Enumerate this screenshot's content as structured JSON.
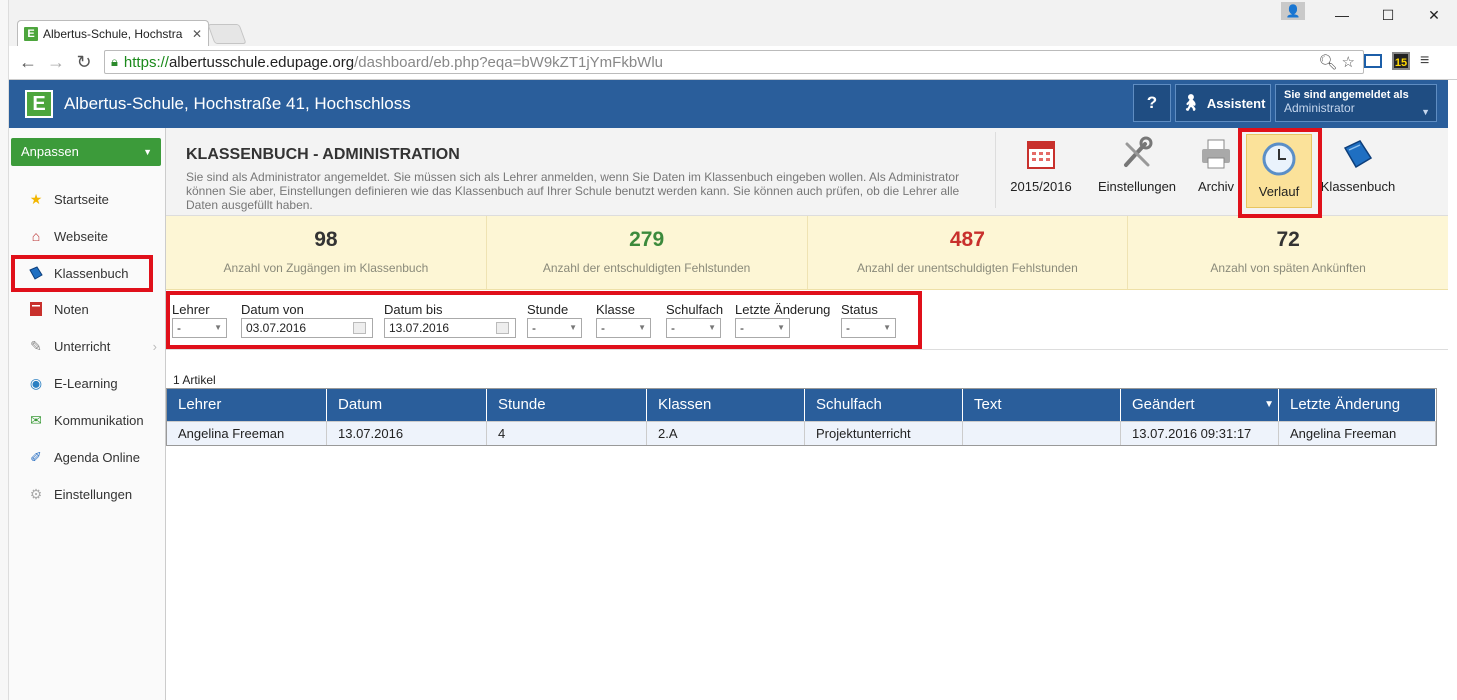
{
  "browser": {
    "tab_title": "Albertus-Schule, Hochstra",
    "url_https": "https://",
    "url_host": "albertusschule.edupage.org",
    "url_path": "/dashboard/eb.php?eqa=bW9kZT1jYmFkbWlu",
    "ext_badge": "15"
  },
  "header": {
    "logo_letter": "E",
    "school_name": "Albertus-Schule, Hochstraße 41, Hochschloss",
    "help_label": "?",
    "assistant_label": "Assistent",
    "login_label": "Sie sind angemeldet als",
    "login_user": "Administrator"
  },
  "sidebar": {
    "anpassen_label": "Anpassen",
    "items": [
      {
        "label": "Startseite",
        "icon": "star-icon"
      },
      {
        "label": "Webseite",
        "icon": "house-icon"
      },
      {
        "label": "Klassenbuch",
        "icon": "book-icon"
      },
      {
        "label": "Noten",
        "icon": "grades-icon"
      },
      {
        "label": "Unterricht",
        "icon": "teaching-icon"
      },
      {
        "label": "E-Learning",
        "icon": "elearning-icon"
      },
      {
        "label": "Kommunikation",
        "icon": "communication-icon"
      },
      {
        "label": "Agenda Online",
        "icon": "pen-icon"
      },
      {
        "label": "Einstellungen",
        "icon": "settings-icon"
      }
    ]
  },
  "page": {
    "title": "KLASSENBUCH - ADMINISTRATION",
    "description": "Sie sind als Administrator angemeldet. Sie müssen sich als Lehrer anmelden, wenn Sie Daten im Klassenbuch eingeben wollen. Als Administrator können Sie aber, Einstellungen definieren wie das Klassenbuch auf Ihrer Schule benutzt werden kann. Sie können auch prüfen, ob die Lehrer alle Daten ausgefüllt haben."
  },
  "tools": {
    "year": "2015/2016",
    "settings": "Einstellungen",
    "archive": "Archiv",
    "history": "Verlauf",
    "classbook": "Klassenbuch"
  },
  "stats": [
    {
      "value": "98",
      "label": "Anzahl von Zugängen im Klassenbuch",
      "color": "#333333"
    },
    {
      "value": "279",
      "label": "Anzahl der entschuldigten Fehlstunden",
      "color": "#3c8a3c"
    },
    {
      "value": "487",
      "label": "Anzahl der unentschuldigten Fehlstunden",
      "color": "#c8302c"
    },
    {
      "value": "72",
      "label": "Anzahl von späten Ankünften",
      "color": "#333333"
    }
  ],
  "filters": {
    "teacher": {
      "label": "Lehrer",
      "value": "-"
    },
    "date_from": {
      "label": "Datum von",
      "value": "03.07.2016"
    },
    "date_to": {
      "label": "Datum bis",
      "value": "13.07.2016"
    },
    "lesson": {
      "label": "Stunde",
      "value": "-"
    },
    "class": {
      "label": "Klasse",
      "value": "-"
    },
    "subject": {
      "label": "Schulfach",
      "value": "-"
    },
    "last_change": {
      "label": "Letzte Änderung",
      "value": "-"
    },
    "status": {
      "label": "Status",
      "value": "-"
    }
  },
  "table": {
    "count_label": "1 Artikel",
    "columns": [
      "Lehrer",
      "Datum",
      "Stunde",
      "Klassen",
      "Schulfach",
      "Text",
      "Geändert",
      "Letzte Änderung"
    ],
    "rows": [
      [
        "Angelina Freeman",
        "13.07.2016",
        "4",
        "2.A",
        "Projektunterricht",
        "",
        "13.07.2016 09:31:17",
        "Angelina Freeman"
      ]
    ]
  },
  "colors": {
    "brand_blue": "#2a5e9b",
    "accent_green": "#3c9b3a",
    "highlight_red": "#e0101a"
  }
}
